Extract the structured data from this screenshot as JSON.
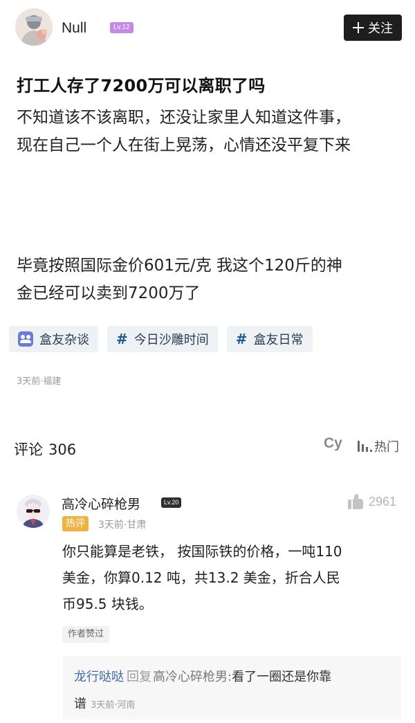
{
  "header": {
    "username": "Null",
    "level": "Lv.12",
    "follow_label": "关注"
  },
  "post": {
    "title": "打工人存了7200万可以离职了吗",
    "paragraph1": [
      "不知道该不该离职，还没让家里人知道这件事，",
      "现在自己一个人在街上晃荡，心情还没平复下来"
    ],
    "paragraph2": [
      "毕竟按照国际金价601元/克  我这个120斤的神",
      "金已经可以卖到7200万了"
    ],
    "tags": [
      {
        "label": "盒友杂谈",
        "icon": "group-icon"
      },
      {
        "label": "今日沙雕时间",
        "icon": "hash-icon"
      },
      {
        "label": "盒友日常",
        "icon": "hash-icon"
      }
    ],
    "meta": "3天前·福建"
  },
  "comments_header": {
    "label": "评论",
    "count": "306",
    "cy_label": "Cy",
    "sort_label": "热门"
  },
  "comment": {
    "username": "高冷心碎枪男",
    "level": "Lv.20",
    "badge": "热评",
    "meta": "3天前·甘肃",
    "likes": "2961",
    "body": [
      "你只能算是老铁，  按国际铁的价格，一吨110",
      "美金，你算0.12 吨，共13.2 美金，折合人民",
      "币95.5 块钱。"
    ],
    "author_liked": "作者赞过",
    "reply": {
      "name": "龙行哒哒",
      "reply_word": "回复",
      "target": "高冷心碎枪男:",
      "text_line1": "看了一圈还是你靠",
      "text_line2": "谱",
      "meta": "3天前·河南"
    }
  },
  "colors": {
    "follow_bg": "#1e1e1e",
    "level_badge": "#c688e8",
    "hot_badge": "#f2b23e",
    "tag_bg": "#eef2f5",
    "reply_name": "#3a6bb2"
  }
}
